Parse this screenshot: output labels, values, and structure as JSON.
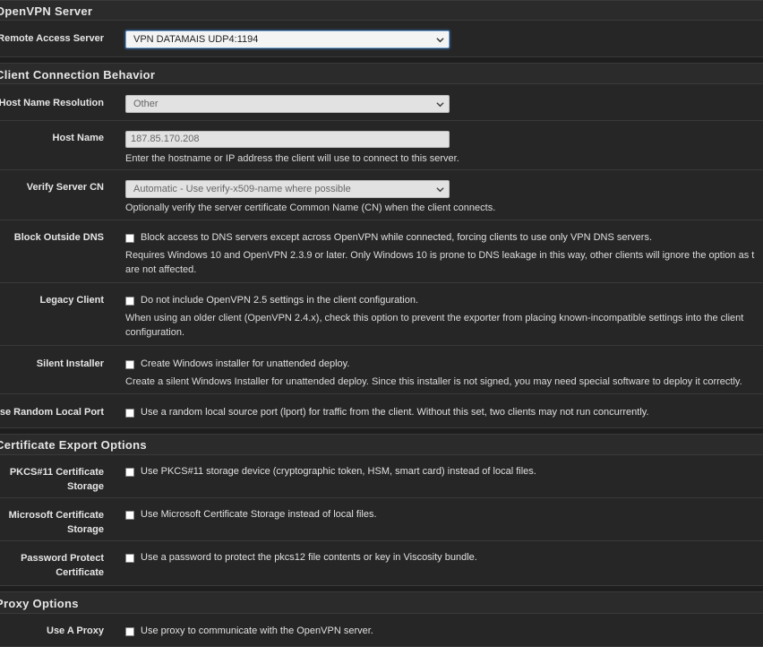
{
  "sections": {
    "openvpn_server": "OpenVPN Server",
    "client_connection": "Client Connection Behavior",
    "certificate_export": "Certificate Export Options",
    "proxy": "Proxy Options"
  },
  "remote_access": {
    "label": "Remote Access Server",
    "value": "VPN DATAMAIS UDP4:1194"
  },
  "host_name_resolution": {
    "label": "Host Name Resolution",
    "value": "Other"
  },
  "host_name": {
    "label": "Host Name",
    "value": "187.85.170.208",
    "help": "Enter the hostname or IP address the client will use to connect to this server."
  },
  "verify_server_cn": {
    "label": "Verify Server CN",
    "value": "Automatic - Use verify-x509-name where possible",
    "help": "Optionally verify the server certificate Common Name (CN) when the client connects."
  },
  "block_outside_dns": {
    "label": "Block Outside DNS",
    "checkbox": "Block access to DNS servers except across OpenVPN while connected, forcing clients to use only VPN DNS servers.",
    "help1": "Requires Windows 10 and OpenVPN 2.3.9 or later. Only Windows 10 is prone to DNS leakage in this way, other clients will ignore the option as t",
    "help2": "are not affected."
  },
  "legacy_client": {
    "label": "Legacy Client",
    "checkbox": "Do not include OpenVPN 2.5 settings in the client configuration.",
    "help1": "When using an older client (OpenVPN 2.4.x), check this option to prevent the exporter from placing known-incompatible settings into the client",
    "help2": "configuration."
  },
  "silent_installer": {
    "label": "Silent Installer",
    "checkbox": "Create Windows installer for unattended deploy.",
    "help": "Create a silent Windows Installer for unattended deploy. Since this installer is not signed, you may need special software to deploy it correctly."
  },
  "random_local_port": {
    "label": "Use Random Local Port",
    "checkbox": "Use a random local source port (lport) for traffic from the client. Without this set, two clients may not run concurrently."
  },
  "pkcs11": {
    "label1": "PKCS#11 Certificate",
    "label2": "Storage",
    "checkbox": "Use PKCS#11 storage device (cryptographic token, HSM, smart card) instead of local files."
  },
  "ms_cert": {
    "label1": "Microsoft Certificate",
    "label2": "Storage",
    "checkbox": "Use Microsoft Certificate Storage instead of local files."
  },
  "password_protect": {
    "label1": "Password Protect",
    "label2": "Certificate",
    "checkbox": "Use a password to protect the pkcs12 file contents or key in Viscosity bundle."
  },
  "use_proxy": {
    "label": "Use A Proxy",
    "checkbox": "Use proxy to communicate with the OpenVPN server."
  }
}
